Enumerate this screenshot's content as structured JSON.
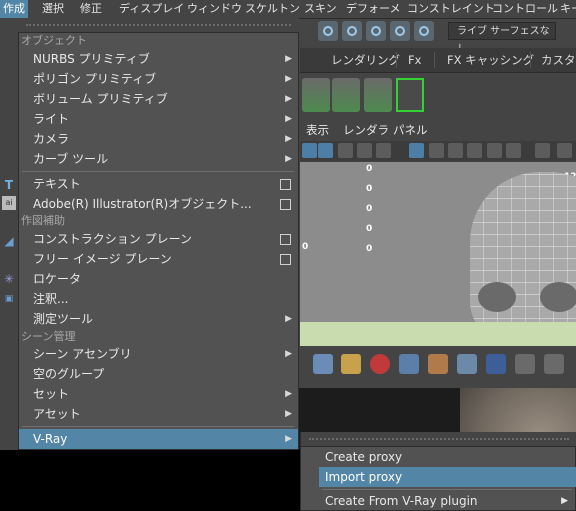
{
  "menubar": [
    "作成",
    "選択",
    "修正",
    "ディスプレイ",
    "ウィンドウ",
    "スケルトン",
    "スキン",
    "デフォーメ",
    "コンストレイント",
    "コントロール",
    "キー"
  ],
  "toolbar": {
    "render_dropdown": "ライブ サーフェスなし"
  },
  "shelf_tabs": [
    "レンダリング",
    "Fx",
    "FX キャッシング",
    "カスタム"
  ],
  "panel_menu": [
    "表示",
    "レンダラ",
    "パネル"
  ],
  "viewport": {
    "hud_values": [
      "0",
      "0",
      "0",
      "0",
      "0",
      "0"
    ],
    "hud_right": "12"
  },
  "main_menu": {
    "section_objects": "オブジェクト",
    "items_objects": [
      {
        "label": "NURBS プリミティブ"
      },
      {
        "label": "ポリゴン プリミティブ"
      },
      {
        "label": "ボリューム プリミティブ"
      },
      {
        "label": "ライト"
      },
      {
        "label": "カメラ"
      },
      {
        "label": "カーブ ツール"
      }
    ],
    "items_text": [
      {
        "label": "テキスト"
      },
      {
        "label": "Adobe(R) Illustrator(R)オブジェクト..."
      }
    ],
    "section_construction": "作図補助",
    "items_construction": [
      {
        "label": "コンストラクション プレーン"
      },
      {
        "label": "フリー イメージ プレーン"
      },
      {
        "label": "ロケータ"
      },
      {
        "label": "注釈..."
      },
      {
        "label": "測定ツール"
      }
    ],
    "section_scene": "シーン管理",
    "items_scene": [
      {
        "label": "シーン アセンブリ"
      },
      {
        "label": "空のグループ"
      },
      {
        "label": "セット"
      },
      {
        "label": "アセット"
      }
    ],
    "vray": "V-Ray"
  },
  "vray_submenu": {
    "create_proxy": "Create proxy",
    "import_proxy": "Import proxy",
    "create_from_plugin": "Create From V-Ray plugin"
  },
  "colors": {
    "highlight": "#5285a6",
    "menu_bg": "#525252",
    "app_bg": "#444444"
  }
}
